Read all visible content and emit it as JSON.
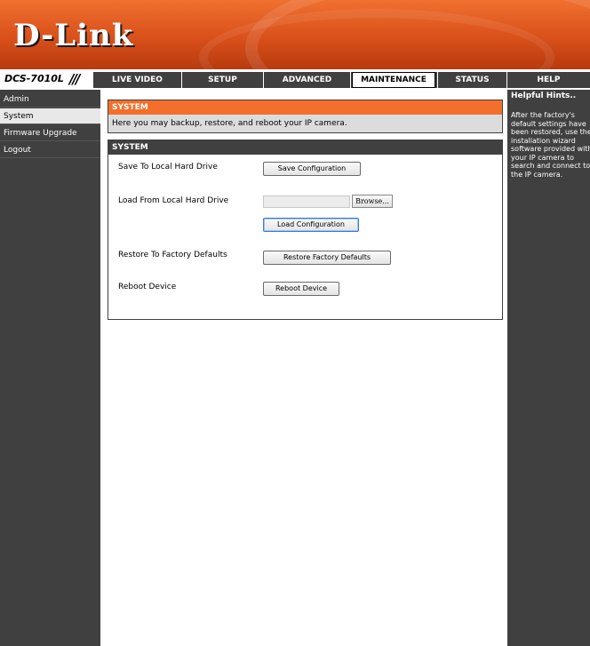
{
  "brand": {
    "logo_text": "D-Link",
    "model": "DCS-7010L",
    "accent": "#f2702c",
    "dark": "#404040"
  },
  "nav": {
    "tabs": [
      {
        "label": "LIVE VIDEO"
      },
      {
        "label": "SETUP"
      },
      {
        "label": "ADVANCED"
      },
      {
        "label": "MAINTENANCE",
        "active": true
      },
      {
        "label": "STATUS"
      },
      {
        "label": "HELP"
      }
    ]
  },
  "sidebar": {
    "items": [
      {
        "label": "Admin"
      },
      {
        "label": "System",
        "active": true
      },
      {
        "label": "Firmware Upgrade"
      },
      {
        "label": "Logout"
      }
    ]
  },
  "intro": {
    "title": "SYSTEM",
    "text": "Here you may backup, restore, and reboot your IP camera."
  },
  "system": {
    "title": "SYSTEM",
    "save_label": "Save To Local Hard Drive",
    "save_button": "Save Configuration",
    "load_label": "Load From Local Hard Drive",
    "file_value": "",
    "browse_button": "Browse...",
    "load_button": "Load Configuration",
    "restore_label": "Restore To Factory Defaults",
    "restore_button": "Restore Factory Defaults",
    "reboot_label": "Reboot Device",
    "reboot_button": "Reboot Device"
  },
  "help": {
    "title": "Helpful Hints..",
    "text": "After the factory's default settings have been restored, use the installation wizard software provided with your IP camera to search and connect to the IP camera."
  }
}
